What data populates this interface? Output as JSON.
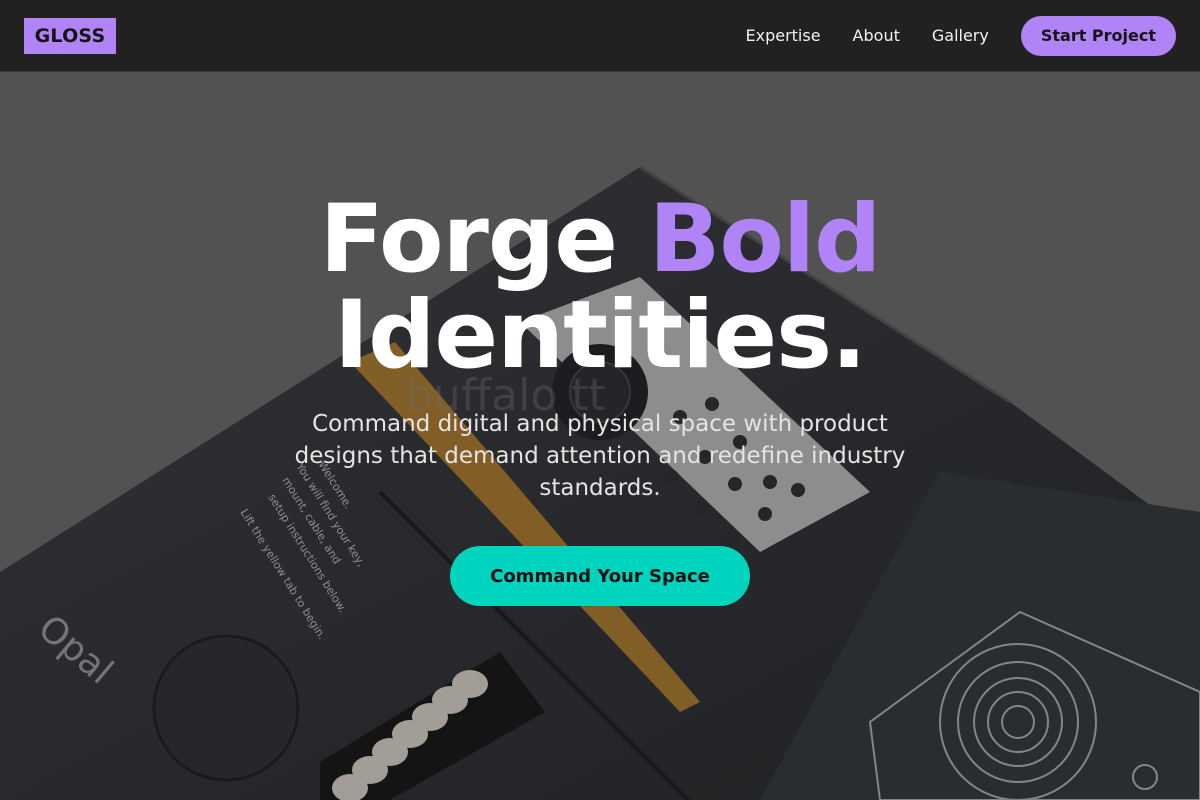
{
  "brand": {
    "logo": "GLOSS",
    "accent_color": "#b084f7",
    "cta_color": "#00d4bf"
  },
  "nav": {
    "links": [
      "Expertise",
      "About",
      "Gallery"
    ],
    "cta_label": "Start Project"
  },
  "hero": {
    "headline_part1": "Forge ",
    "headline_accent": "Bold",
    "headline_part2": "Identities.",
    "subheading": "Command digital and physical space with product designs that demand attention and redefine industry standards.",
    "cta_label": "Command Your Space",
    "photo": {
      "box_text": "Welcome. You will find your key, mount, cable, and setup instructions below. Lift the yellow tab to begin.",
      "brand_mark": "Opal",
      "watermark": "buffalo tt"
    }
  }
}
